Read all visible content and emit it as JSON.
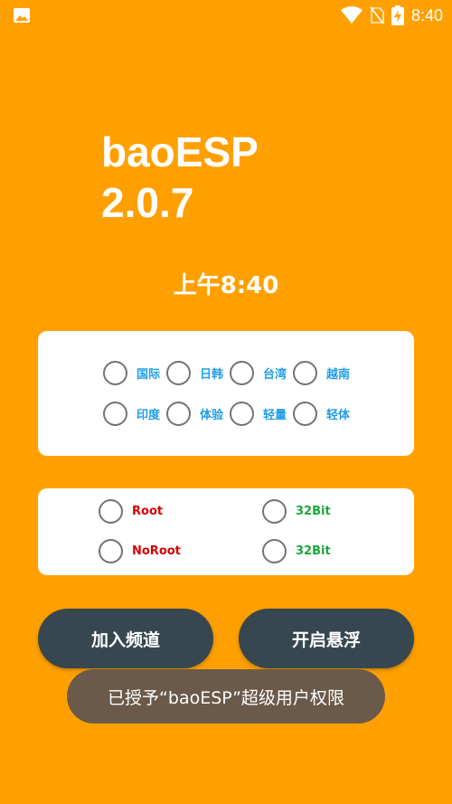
{
  "status_bar": {
    "time": "8:40",
    "icons": [
      "image-notification-icon",
      "wifi-icon",
      "no-sim-icon",
      "battery-charging-icon"
    ]
  },
  "app": {
    "title_line1": "baoESP",
    "title_line2": "2.0.7",
    "clock": "上午8:40"
  },
  "region_options": [
    {
      "label": "国际",
      "checked": false
    },
    {
      "label": "日韩",
      "checked": false
    },
    {
      "label": "台湾",
      "checked": false
    },
    {
      "label": "越南",
      "checked": false
    },
    {
      "label": "印度",
      "checked": false
    },
    {
      "label": "体验",
      "checked": false
    },
    {
      "label": "轻量",
      "checked": false
    },
    {
      "label": "轻体",
      "checked": false
    }
  ],
  "mode_options": [
    {
      "label": "Root",
      "checked": false
    },
    {
      "label": "32Bit",
      "checked": false
    },
    {
      "label": "NoRoot",
      "checked": false
    },
    {
      "label": "32Bit",
      "checked": false
    }
  ],
  "buttons": {
    "join_channel": "加入频道",
    "open_float": "开启悬浮"
  },
  "toast": {
    "message": "已授予“baoESP”超级用户权限"
  },
  "colors": {
    "background": "#FFA000",
    "button": "#37474F",
    "toast": "#6B5A49",
    "label_blue": "#1E9EE8",
    "label_red": "#D50000",
    "label_green": "#1BA83A"
  }
}
